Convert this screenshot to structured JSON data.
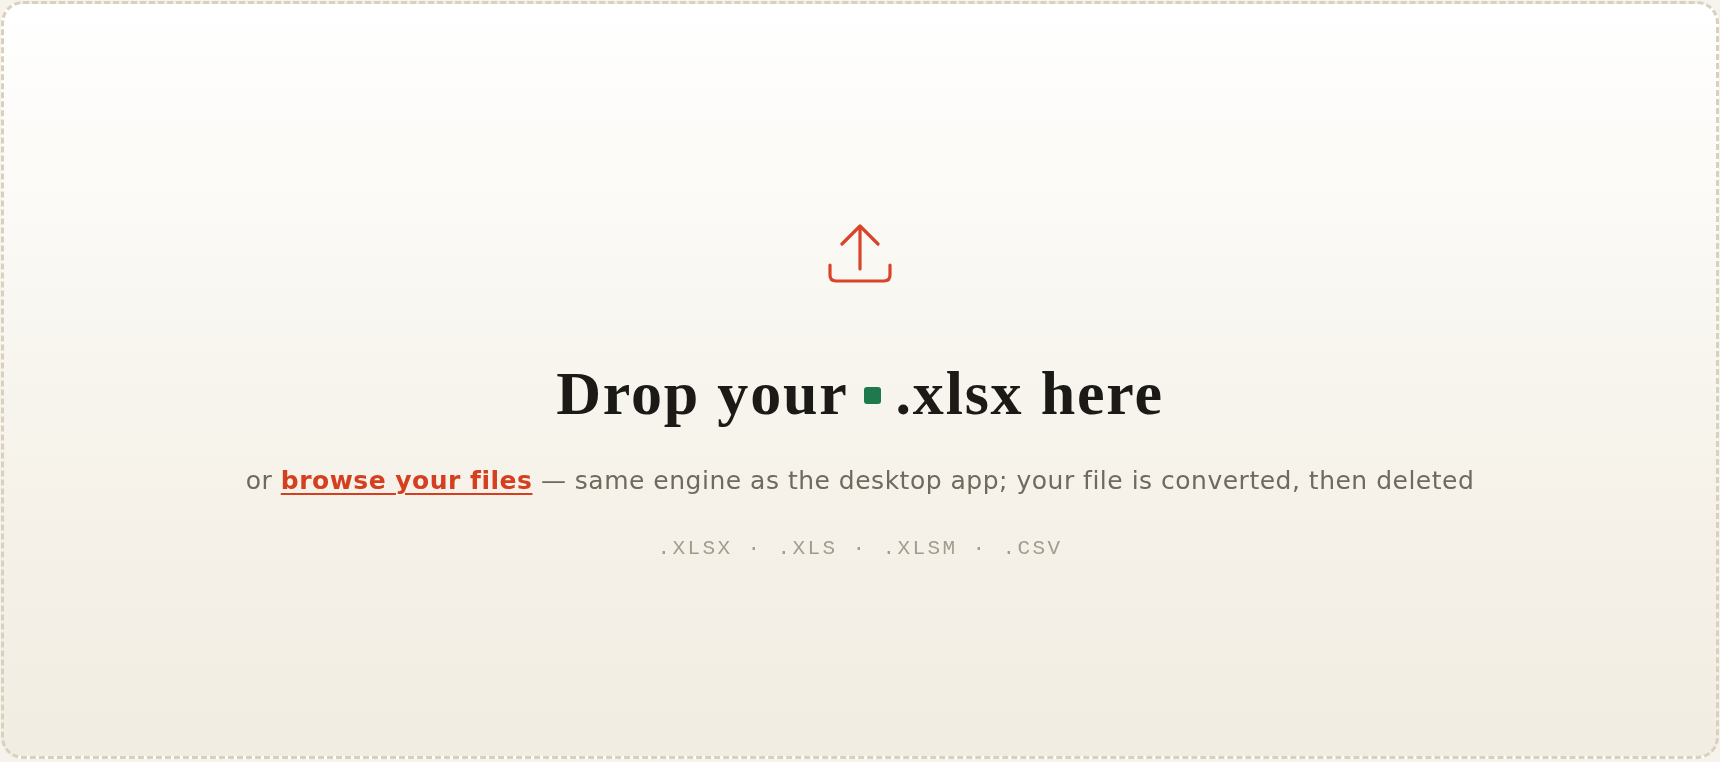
{
  "drop_zone": {
    "heading": {
      "before": "Drop your",
      "after": ".xlsx here"
    },
    "hint": {
      "before": "or",
      "link": "browse your files",
      "after": "— same engine as the desktop app; your file is converted, then deleted"
    },
    "formats": ".XLSX · .XLS · .XLSM · .CSV"
  }
}
